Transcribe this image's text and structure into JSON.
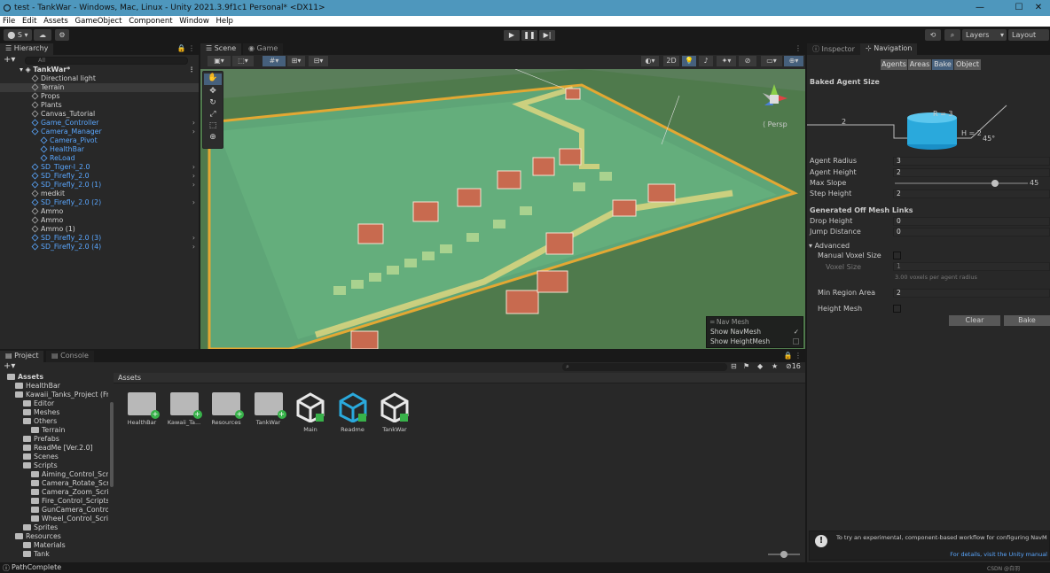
{
  "window": {
    "title": "test - TankWar - Windows, Mac, Linux - Unity 2021.3.9f1c1 Personal* <DX11>"
  },
  "menu": [
    "File",
    "Edit",
    "Assets",
    "GameObject",
    "Component",
    "Window",
    "Help"
  ],
  "toolbar": {
    "account_label": "S",
    "layers_label": "Layers",
    "layout_label": "Layout"
  },
  "hierarchy": {
    "tab": "Hierarchy",
    "search_placeholder": "All",
    "scene": "TankWar*",
    "items": [
      {
        "label": "Directional light",
        "indent": 0
      },
      {
        "label": "Terrain",
        "indent": 0
      },
      {
        "label": "Props",
        "indent": 0
      },
      {
        "label": "Plants",
        "indent": 0
      },
      {
        "label": "Canvas_Tutorial",
        "indent": 0
      },
      {
        "label": "Game_Controller",
        "indent": 0,
        "blue": true
      },
      {
        "label": "Camera_Manager",
        "indent": 0,
        "blue": true
      },
      {
        "label": "Camera_Pivot",
        "indent": 1,
        "blue": true
      },
      {
        "label": "HealthBar",
        "indent": 1,
        "blue": true
      },
      {
        "label": "ReLoad",
        "indent": 1,
        "blue": true
      },
      {
        "label": "SD_Tiger-I_2.0",
        "indent": 0,
        "blue": true
      },
      {
        "label": "SD_Firefly_2.0",
        "indent": 0,
        "blue": true
      },
      {
        "label": "SD_Firefly_2.0 (1)",
        "indent": 0,
        "blue": true
      },
      {
        "label": "medkit",
        "indent": 0
      },
      {
        "label": "SD_Firefly_2.0 (2)",
        "indent": 0,
        "blue": true
      },
      {
        "label": "Ammo",
        "indent": 0
      },
      {
        "label": "Ammo",
        "indent": 0
      },
      {
        "label": "Ammo (1)",
        "indent": 0
      },
      {
        "label": "SD_Firefly_2.0 (3)",
        "indent": 0,
        "blue": true
      },
      {
        "label": "SD_Firefly_2.0 (4)",
        "indent": 0,
        "blue": true
      }
    ]
  },
  "scene_view": {
    "tabs": [
      "Scene",
      "Game"
    ],
    "mode_2d": "2D",
    "persp": "Persp",
    "overlay": {
      "title": "Nav Mesh",
      "show_navmesh": "Show NavMesh",
      "show_heightmesh": "Show HeightMesh"
    }
  },
  "inspector": {
    "tabs": [
      "Inspector",
      "Navigation"
    ],
    "nav_buttons": [
      "Agents",
      "Areas",
      "Bake",
      "Object"
    ],
    "baked_agent_size": "Baked Agent Size",
    "diagram": {
      "r": "R = 3",
      "h": "H = 2",
      "angle": "45°",
      "step": "2"
    },
    "fields": [
      {
        "label": "Agent Radius",
        "value": "3"
      },
      {
        "label": "Agent Height",
        "value": "2"
      },
      {
        "label": "Max Slope",
        "value": "45"
      },
      {
        "label": "Step Height",
        "value": "2"
      }
    ],
    "max_slope_fraction": 0.75,
    "offmesh_header": "Generated Off Mesh Links",
    "offmesh_fields": [
      {
        "label": "Drop Height",
        "value": "0"
      },
      {
        "label": "Jump Distance",
        "value": "0"
      }
    ],
    "advanced": "Advanced",
    "manual_voxel": "Manual Voxel Size",
    "voxel_size": "Voxel Size",
    "voxel_value": "1",
    "voxel_hint": "3.00 voxels per agent radius",
    "min_region": "Min Region Area",
    "min_region_value": "2",
    "height_mesh": "Height Mesh",
    "clear": "Clear",
    "bake": "Bake",
    "notice": "To try an experimental, component-based workflow for configuring NavMeshes, install the AI Navigation package.",
    "notice_link": "For details, visit the Unity manual"
  },
  "project": {
    "tabs": [
      "Project",
      "Console"
    ],
    "tree": [
      {
        "label": "Assets",
        "indent": 0,
        "bold": true
      },
      {
        "label": "HealthBar",
        "indent": 1
      },
      {
        "label": "Kawaii_Tanks_Project (Fre",
        "indent": 1
      },
      {
        "label": "Editor",
        "indent": 2
      },
      {
        "label": "Meshes",
        "indent": 2
      },
      {
        "label": "Others",
        "indent": 2
      },
      {
        "label": "Terrain",
        "indent": 3
      },
      {
        "label": "Prefabs",
        "indent": 2
      },
      {
        "label": "ReadMe [Ver.2.0]",
        "indent": 2
      },
      {
        "label": "Scenes",
        "indent": 2
      },
      {
        "label": "Scripts",
        "indent": 2
      },
      {
        "label": "Aiming_Control_Scrip",
        "indent": 3
      },
      {
        "label": "Camera_Rotate_Scrip",
        "indent": 3
      },
      {
        "label": "Camera_Zoom_Script",
        "indent": 3
      },
      {
        "label": "Fire_Control_Scripts",
        "indent": 3
      },
      {
        "label": "GunCamera_Control_",
        "indent": 3
      },
      {
        "label": "Wheel_Control_Script",
        "indent": 3
      },
      {
        "label": "Sprites",
        "indent": 2
      },
      {
        "label": "Resources",
        "indent": 1
      },
      {
        "label": "Materials",
        "indent": 2
      },
      {
        "label": "Tank",
        "indent": 2
      }
    ],
    "breadcrumb": "Assets",
    "hidden_count": "16",
    "assets": [
      {
        "label": "HealthBar",
        "kind": "folder"
      },
      {
        "label": "Kawaii_Ta...",
        "kind": "folder"
      },
      {
        "label": "Resources",
        "kind": "folder"
      },
      {
        "label": "TankWar",
        "kind": "folder"
      },
      {
        "label": "Main",
        "kind": "unity"
      },
      {
        "label": "Readme",
        "kind": "readme"
      },
      {
        "label": "TankWar",
        "kind": "unity"
      }
    ]
  },
  "status": {
    "text": "PathComplete",
    "watermark": "CSDN @白羽"
  }
}
